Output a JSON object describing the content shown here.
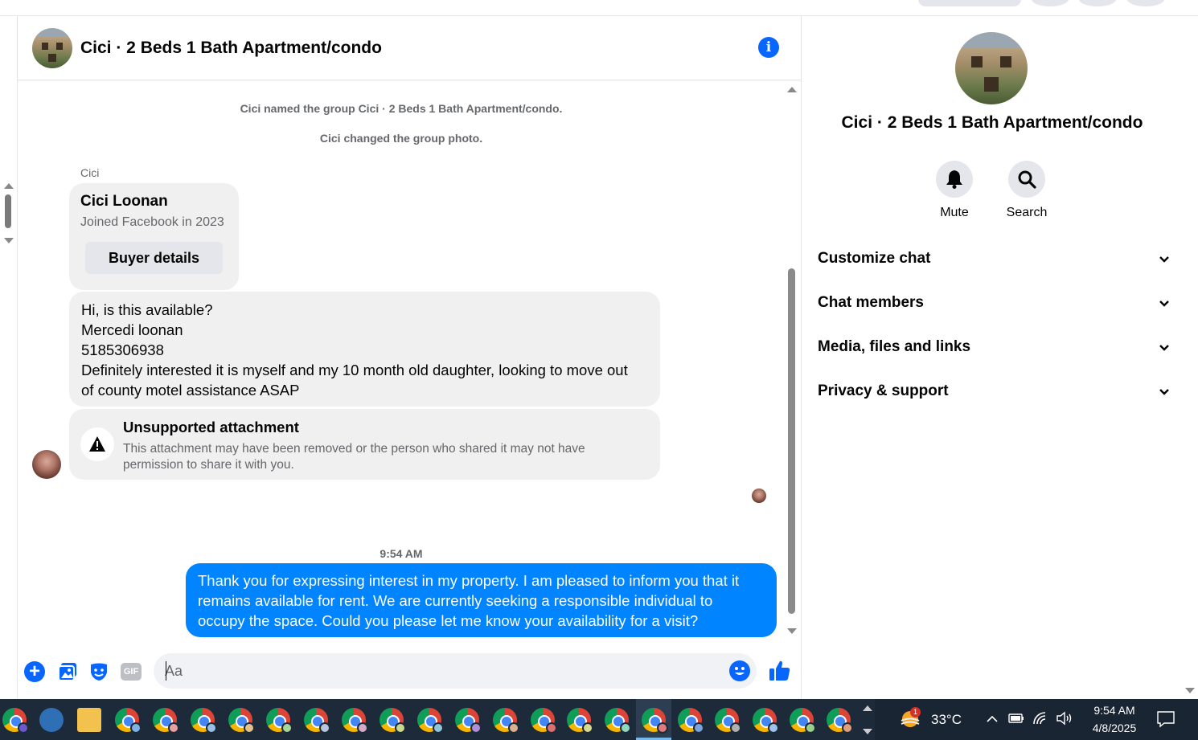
{
  "header": {
    "title": "Cici · 2 Beds 1 Bath Apartment/condo"
  },
  "messages": {
    "system_notes": [
      "Cici named the group Cici · 2 Beds 1 Bath Apartment/condo.",
      "Cici changed the group photo."
    ],
    "sender_name": "Cici",
    "profile_card": {
      "name": "Cici Loonan",
      "joined": "Joined Facebook in 2023",
      "button_label": "Buyer details"
    },
    "incoming_lines": [
      "Hi, is this available?",
      "Mercedi loonan",
      "5185306938",
      "Definitely interested it is myself and my 10 month old daughter, looking to move out",
      "of county motel assistance ASAP"
    ],
    "attachment": {
      "title": "Unsupported attachment",
      "description": "This attachment may have been removed or the person who shared it may not have permission to share it with you."
    },
    "timestamp": "9:54 AM",
    "outgoing_lines": [
      "Thank you for expressing interest in my property. I am pleased to inform you that it",
      "remains available for rent. We are currently seeking a responsible individual to",
      "occupy the space. Could you please let me know your availability for a visit?"
    ]
  },
  "composer": {
    "placeholder": "Aa",
    "gif_label": "GIF"
  },
  "panel": {
    "title": "Cici · 2 Beds 1 Bath Apartment/condo",
    "actions": {
      "mute": "Mute",
      "search": "Search"
    },
    "sections": [
      "Customize chat",
      "Chat members",
      "Media, files and links",
      "Privacy & support"
    ]
  },
  "taskbar": {
    "temperature": "33°C",
    "weather_badge": "1",
    "time": "9:54 AM",
    "date": "4/8/2025"
  },
  "colors": {
    "accent": "#0866ff",
    "outgoing_bubble": "#0084ff",
    "incoming_bubble": "#f0f0f0",
    "taskbar": "#1c2a3a"
  }
}
